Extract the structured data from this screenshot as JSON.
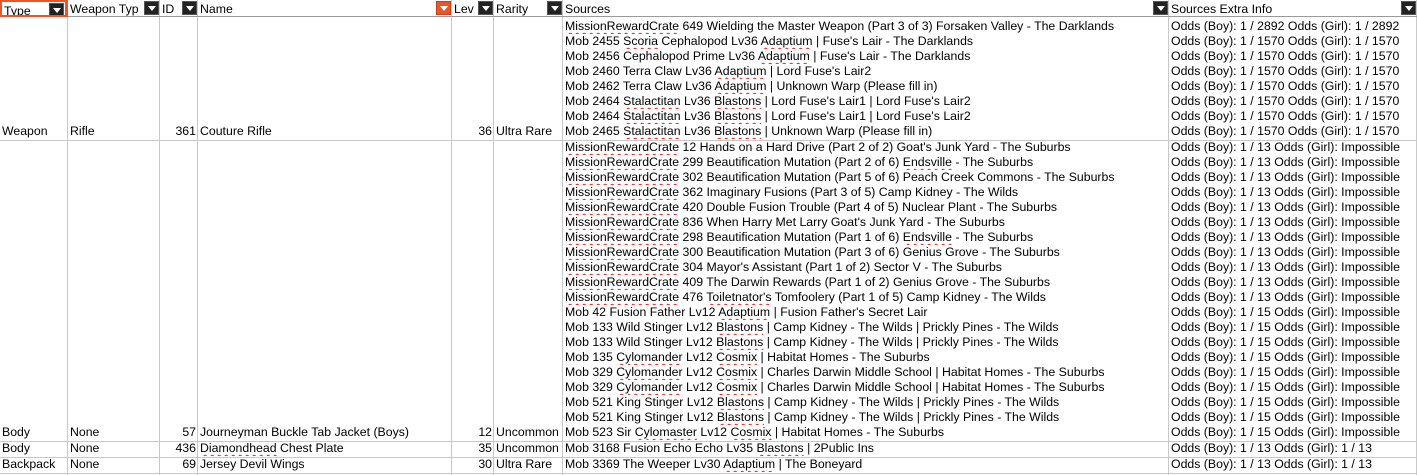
{
  "columns": {
    "type": "Type",
    "weapon_type": "Weapon Typ",
    "id": "ID",
    "name": "Name",
    "level": "Lev",
    "rarity": "Rarity",
    "sources": "Sources",
    "sources_extra": "Sources Extra Info"
  },
  "rows": [
    {
      "type": "Weapon",
      "weapon_type": "Rifle",
      "id": "361",
      "name": "Couture Rifle",
      "level": "36",
      "rarity": "Ultra Rare",
      "sources": [
        [
          "MissionRewardCrate 649 Wielding the Master Weapon (Part 3 of 3) Forsaken Valley - The Darklands",
          "Odds (Boy): 1 / 2892 Odds (Girl): 1 / 2892"
        ],
        [
          "Mob 2455 Scoria Cephalopod Lv36 Adaptium | Fuse's Lair - The Darklands",
          "Odds (Boy): 1 / 1570 Odds (Girl): 1 / 1570"
        ],
        [
          "Mob 2456 Cephalopod Prime Lv36 Adaptium | Fuse's Lair - The Darklands",
          "Odds (Boy): 1 / 1570 Odds (Girl): 1 / 1570"
        ],
        [
          "Mob 2460 Terra Claw Lv36 Adaptium | Lord Fuse's Lair2",
          "Odds (Boy): 1 / 1570 Odds (Girl): 1 / 1570"
        ],
        [
          "Mob 2462 Terra Claw Lv36 Adaptium | Unknown Warp (Please fill in)",
          "Odds (Boy): 1 / 1570 Odds (Girl): 1 / 1570"
        ],
        [
          "Mob 2464 Stalactitan Lv36 Blastons | Lord Fuse's Lair1 | Lord Fuse's Lair2",
          "Odds (Boy): 1 / 1570 Odds (Girl): 1 / 1570"
        ],
        [
          "Mob 2464 Stalactitan Lv36 Blastons | Lord Fuse's Lair1 | Lord Fuse's Lair2",
          "Odds (Boy): 1 / 1570 Odds (Girl): 1 / 1570"
        ],
        [
          "Mob 2465 Stalactitan Lv36 Blastons | Unknown Warp (Please fill in)",
          "Odds (Boy): 1 / 1570 Odds (Girl): 1 / 1570"
        ]
      ]
    },
    {
      "type": "Body",
      "weapon_type": "None",
      "id": "57",
      "name": "Journeyman Buckle Tab Jacket (Boys)",
      "level": "12",
      "rarity": "Uncommon",
      "sources": [
        [
          "MissionRewardCrate 12 Hands on a Hard Drive (Part 2 of 2) Goat's Junk Yard - The Suburbs",
          "Odds (Boy): 1 / 13 Odds (Girl): Impossible"
        ],
        [
          "MissionRewardCrate 299 Beautification Mutation (Part 2 of 6) Endsville - The Suburbs",
          "Odds (Boy): 1 / 13 Odds (Girl): Impossible"
        ],
        [
          "MissionRewardCrate 302 Beautification Mutation (Part 5 of 6) Peach Creek Commons - The Suburbs",
          "Odds (Boy): 1 / 13 Odds (Girl): Impossible"
        ],
        [
          "MissionRewardCrate 362 Imaginary Fusions (Part 3 of 5) Camp Kidney - The Wilds",
          "Odds (Boy): 1 / 13 Odds (Girl): Impossible"
        ],
        [
          "MissionRewardCrate 420 Double Fusion Trouble (Part 4 of 5) Nuclear Plant - The Suburbs",
          "Odds (Boy): 1 / 13 Odds (Girl): Impossible"
        ],
        [
          "MissionRewardCrate 836 When Harry Met Larry Goat's Junk Yard - The Suburbs",
          "Odds (Boy): 1 / 13 Odds (Girl): Impossible"
        ],
        [
          "MissionRewardCrate 298 Beautification Mutation (Part 1 of 6) Endsville - The Suburbs",
          "Odds (Boy): 1 / 13 Odds (Girl): Impossible"
        ],
        [
          "MissionRewardCrate 300 Beautification Mutation (Part 3 of 6) Genius Grove - The Suburbs",
          "Odds (Boy): 1 / 13 Odds (Girl): Impossible"
        ],
        [
          "MissionRewardCrate 304 Mayor's Assistant (Part 1 of 2) Sector V - The Suburbs",
          "Odds (Boy): 1 / 13 Odds (Girl): Impossible"
        ],
        [
          "MissionRewardCrate 409 The Darwin Rewards (Part 1 of 2) Genius Grove - The Suburbs",
          "Odds (Boy): 1 / 13 Odds (Girl): Impossible"
        ],
        [
          "MissionRewardCrate 476 Toiletnator's Tomfoolery (Part 1 of 5) Camp Kidney - The Wilds",
          "Odds (Boy): 1 / 13 Odds (Girl): Impossible"
        ],
        [
          "Mob 42 Fusion Father Lv12 Adaptium | Fusion Father's Secret Lair",
          "Odds (Boy): 1 / 15 Odds (Girl): Impossible"
        ],
        [
          "Mob 133 Wild Stinger Lv12 Blastons | Camp Kidney - The Wilds | Prickly Pines - The Wilds",
          "Odds (Boy): 1 / 15 Odds (Girl): Impossible"
        ],
        [
          "Mob 133 Wild Stinger Lv12 Blastons | Camp Kidney - The Wilds | Prickly Pines - The Wilds",
          "Odds (Boy): 1 / 15 Odds (Girl): Impossible"
        ],
        [
          "Mob 135 Cylomander Lv12 Cosmix | Habitat Homes - The Suburbs",
          "Odds (Boy): 1 / 15 Odds (Girl): Impossible"
        ],
        [
          "Mob 329 Cylomander Lv12 Cosmix | Charles Darwin Middle School | Habitat Homes - The Suburbs",
          "Odds (Boy): 1 / 15 Odds (Girl): Impossible"
        ],
        [
          "Mob 329 Cylomander Lv12 Cosmix | Charles Darwin Middle School | Habitat Homes - The Suburbs",
          "Odds (Boy): 1 / 15 Odds (Girl): Impossible"
        ],
        [
          "Mob 521 King Stinger Lv12 Blastons | Camp Kidney - The Wilds | Prickly Pines - The Wilds",
          "Odds (Boy): 1 / 15 Odds (Girl): Impossible"
        ],
        [
          "Mob 521 King Stinger Lv12 Blastons | Camp Kidney - The Wilds | Prickly Pines - The Wilds",
          "Odds (Boy): 1 / 15 Odds (Girl): Impossible"
        ],
        [
          "Mob 523 Sir Cylomaster Lv12 Cosmix | Habitat Homes - The Suburbs",
          "Odds (Boy): 1 / 15 Odds (Girl): Impossible"
        ]
      ]
    },
    {
      "type": "Body",
      "weapon_type": "None",
      "id": "436",
      "name": "Diamondhead Chest Plate",
      "level": "35",
      "rarity": "Uncommon",
      "sources": [
        [
          "Mob 3168 Fusion Echo Echo Lv35 Blastons | 2Public Ins",
          "Odds (Boy): 1 / 13 Odds (Girl): 1 / 13"
        ]
      ]
    },
    {
      "type": "Backpack",
      "weapon_type": "None",
      "id": "69",
      "name": "Jersey Devil Wings",
      "level": "30",
      "rarity": "Ultra Rare",
      "sources": [
        [
          "Mob 3369 The Weeper Lv30 Adaptium | The Boneyard",
          "Odds (Boy): 1 / 13 Odds (Girl): 1 / 13"
        ]
      ]
    }
  ],
  "misspelled_words": [
    "MissionRewardCrate",
    "Adaptium",
    "Blastons",
    "Stalactitan",
    "Endsville",
    "Toiletnator's",
    "Cylomander",
    "Cylomaster",
    "Cosmix",
    "Diamondhead",
    "Scoria"
  ],
  "colors": {
    "grid": "#c8c8c8",
    "filter_button": "#222222",
    "active_filter": "#e8562a",
    "spellcheck": "#e0231f"
  }
}
